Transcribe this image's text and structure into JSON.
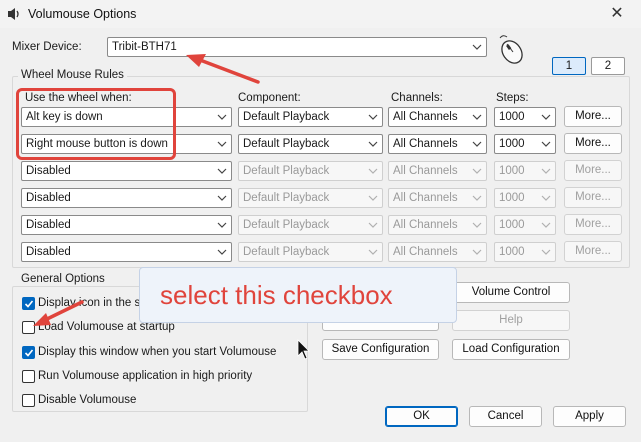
{
  "window": {
    "title": "Volumouse Options",
    "close_glyph": "✕"
  },
  "mixer": {
    "label": "Mixer Device:",
    "value": "Tribit-BTH71"
  },
  "pages": [
    "1",
    "2"
  ],
  "rules": {
    "group_label": "Wheel Mouse Rules",
    "headers": {
      "use_wheel": "Use the wheel when:",
      "component": "Component:",
      "channels": "Channels:",
      "steps": "Steps:"
    },
    "rows": [
      {
        "when": "Alt key is down",
        "component": "Default Playback",
        "channels": "All Channels",
        "steps": "1000",
        "more": "More...",
        "enabled": true
      },
      {
        "when": "Right mouse button is down",
        "component": "Default Playback",
        "channels": "All Channels",
        "steps": "1000",
        "more": "More...",
        "enabled": true
      },
      {
        "when": "Disabled",
        "component": "Default Playback",
        "channels": "All Channels",
        "steps": "1000",
        "more": "More...",
        "enabled": false
      },
      {
        "when": "Disabled",
        "component": "Default Playback",
        "channels": "All Channels",
        "steps": "1000",
        "more": "More...",
        "enabled": false
      },
      {
        "when": "Disabled",
        "component": "Default Playback",
        "channels": "All Channels",
        "steps": "1000",
        "more": "More...",
        "enabled": false
      },
      {
        "when": "Disabled",
        "component": "Default Playback",
        "channels": "All Channels",
        "steps": "1000",
        "more": "More...",
        "enabled": false
      }
    ]
  },
  "general": {
    "group_label": "General Options",
    "options": [
      {
        "label": "Display icon in the system tray",
        "checked": true
      },
      {
        "label": "Load Volumouse at startup",
        "checked": false
      },
      {
        "label": "Display this window when you start Volumouse",
        "checked": true
      },
      {
        "label": "Run Volumouse application in high priority",
        "checked": false
      },
      {
        "label": "Disable Volumouse",
        "checked": false
      }
    ]
  },
  "side_buttons": {
    "about": "About...",
    "volume_control": "Volume Control",
    "help": "Help",
    "save_config": "Save Configuration",
    "load_config": "Load Configuration"
  },
  "dialog_buttons": {
    "ok": "OK",
    "cancel": "Cancel",
    "apply": "Apply"
  },
  "annotation": {
    "callout_text": "select this checkbox",
    "color": "#e0443c"
  },
  "colors": {
    "accent": "#0067c0",
    "annotation_red": "#e0443c"
  }
}
